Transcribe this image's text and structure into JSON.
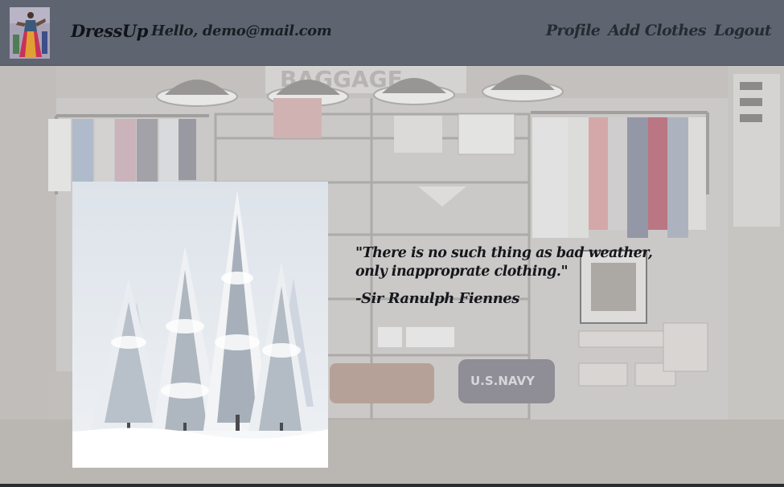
{
  "header": {
    "brand": "DressUp",
    "greeting": "Hello, demo@mail.com",
    "logo_icon": "dress-figure-logo",
    "nav": [
      {
        "label": "Profile"
      },
      {
        "label": "Add Clothes"
      },
      {
        "label": "Logout"
      }
    ],
    "background_color": "#5e6571"
  },
  "hero": {
    "background_image": "clothing-store-interior",
    "photo": "snowy-winter-forest",
    "quote_lines": [
      "\"There is no such thing as bad weather,",
      "only inapproprate clothing.\""
    ],
    "author": "-Sir Ranulph Fiennes"
  }
}
